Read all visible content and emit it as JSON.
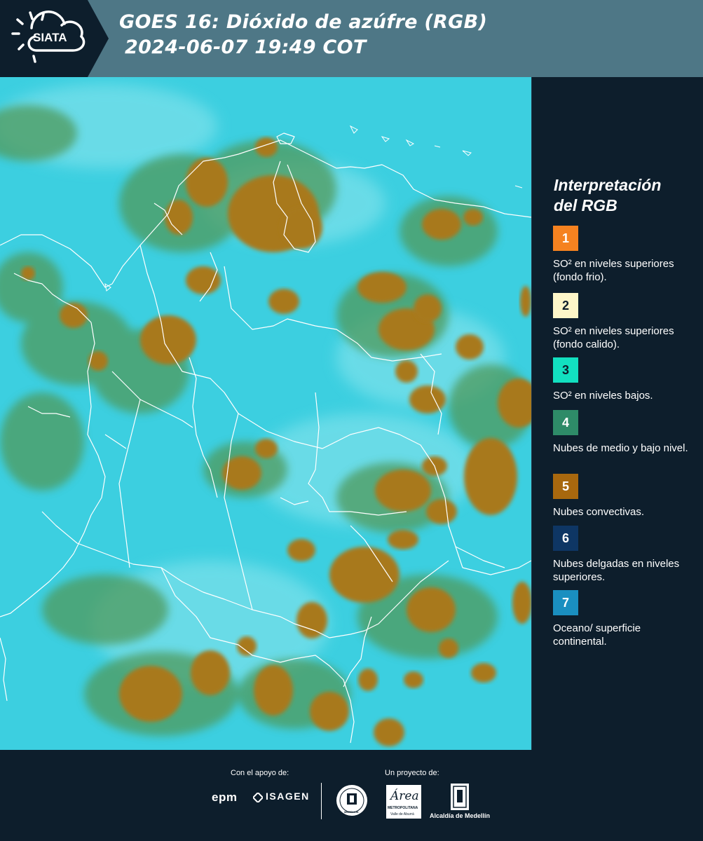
{
  "header": {
    "logo_text": "SIATA",
    "title_line1": "GOES 16: Dióxido de azúfre (RGB)",
    "title_line2": "2024-06-07 19:49 COT"
  },
  "legend": {
    "title_line1": "Interpretación",
    "title_line2": "del RGB",
    "items": [
      {
        "number": "1",
        "color": "#f58220",
        "text": "SO² en niveles superiores (fondo frio)."
      },
      {
        "number": "2",
        "color": "#fdf6c8",
        "text": "SO² en niveles superiores (fondo calido)."
      },
      {
        "number": "3",
        "color": "#12e0c0",
        "text": "SO² en niveles bajos."
      },
      {
        "number": "4",
        "color": "#2e8b68",
        "text": "Nubes de medio y bajo nivel."
      },
      {
        "number": "5",
        "color": "#a8680e",
        "text": "Nubes convectivas."
      },
      {
        "number": "6",
        "color": "#0e3664",
        "text": "Nubes delgadas en niveles superiores."
      },
      {
        "number": "7",
        "color": "#1a8fc0",
        "text": "Oceano/ superficie continental."
      }
    ]
  },
  "map_colors": {
    "background": "#3ccfe0",
    "convective_clouds": "#a8791e",
    "mid_low_clouds": "#4f9a5c",
    "borders": "#ffffff"
  },
  "footer": {
    "support_label": "Con el apoyo de:",
    "project_label": "Un proyecto de:",
    "sponsor1": "epm",
    "sponsor2": "ISAGEN",
    "partner_area_line1": "Área",
    "partner_area_line2": "METROPOLITANA",
    "partner_area_line3": "Valle de Aburrá",
    "partner_alcaldia": "Alcaldía de Medellín",
    "seal_text": "MEDELLIN"
  }
}
